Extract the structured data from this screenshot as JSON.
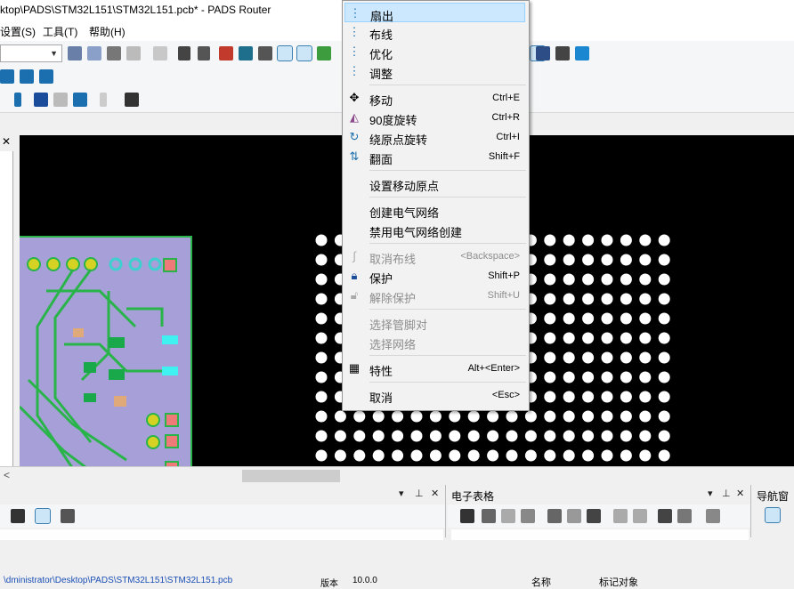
{
  "window": {
    "title": "ktop\\PADS\\STM32L151\\STM32L151.pcb* - PADS Router"
  },
  "menubar": {
    "items": [
      "设置(S)",
      "工具(T)",
      "帮助(H)"
    ]
  },
  "context_menu": {
    "items": [
      {
        "label": "扇出",
        "shortcut": "",
        "icon": "fanout-icon",
        "enabled": true,
        "highlighted": true
      },
      {
        "label": "布线",
        "shortcut": "",
        "icon": "route-icon",
        "enabled": true
      },
      {
        "label": "优化",
        "shortcut": "",
        "icon": "optimize-icon",
        "enabled": true
      },
      {
        "label": "调整",
        "shortcut": "",
        "icon": "tune-icon",
        "enabled": true
      },
      {
        "label": "移动",
        "shortcut": "Ctrl+E",
        "icon": "move-icon",
        "enabled": true
      },
      {
        "label": "90度旋转",
        "shortcut": "Ctrl+R",
        "icon": "rotate90-icon",
        "enabled": true
      },
      {
        "label": "绕原点旋转",
        "shortcut": "Ctrl+I",
        "icon": "rotate-origin-icon",
        "enabled": true
      },
      {
        "label": "翻面",
        "shortcut": "Shift+F",
        "icon": "flip-icon",
        "enabled": true
      },
      {
        "label": "设置移动原点",
        "shortcut": "",
        "icon": "",
        "enabled": true
      },
      {
        "label": "创建电气网络",
        "shortcut": "",
        "icon": "",
        "enabled": true
      },
      {
        "label": "禁用电气网络创建",
        "shortcut": "",
        "icon": "",
        "enabled": true
      },
      {
        "label": "取消布线",
        "shortcut": "<Backspace>",
        "icon": "unroute-icon",
        "enabled": false
      },
      {
        "label": "保护",
        "shortcut": "Shift+P",
        "icon": "lock-icon",
        "enabled": true
      },
      {
        "label": "解除保护",
        "shortcut": "Shift+U",
        "icon": "unlock-icon",
        "enabled": false
      },
      {
        "label": "选择管脚对",
        "shortcut": "",
        "icon": "",
        "enabled": false
      },
      {
        "label": "选择网络",
        "shortcut": "",
        "icon": "",
        "enabled": false
      },
      {
        "label": "特性",
        "shortcut": "Alt+<Enter>",
        "icon": "properties-icon",
        "enabled": true
      },
      {
        "label": "取消",
        "shortcut": "<Esc>",
        "icon": "",
        "enabled": true
      }
    ]
  },
  "panes": {
    "output": {
      "close": "✕",
      "pin": "⊥",
      "dropdown": "▾",
      "status_text": "\\dministrator\\Desktop\\PADS\\STM32L151\\STM32L151.pcb",
      "version_label": "版本",
      "version_value": "10.0.0"
    },
    "spreadsheet": {
      "title": "电子表格",
      "close": "✕",
      "pin": "⊥",
      "dropdown": "▾",
      "col_name": "名称",
      "col_object": "标记对象"
    },
    "navigator": {
      "title": "导航窗"
    }
  },
  "colors": {
    "accent": "#3c7fb1",
    "highlight": "#cce8ff",
    "trace": "#29b44a",
    "board_left": "#a79fd8"
  }
}
